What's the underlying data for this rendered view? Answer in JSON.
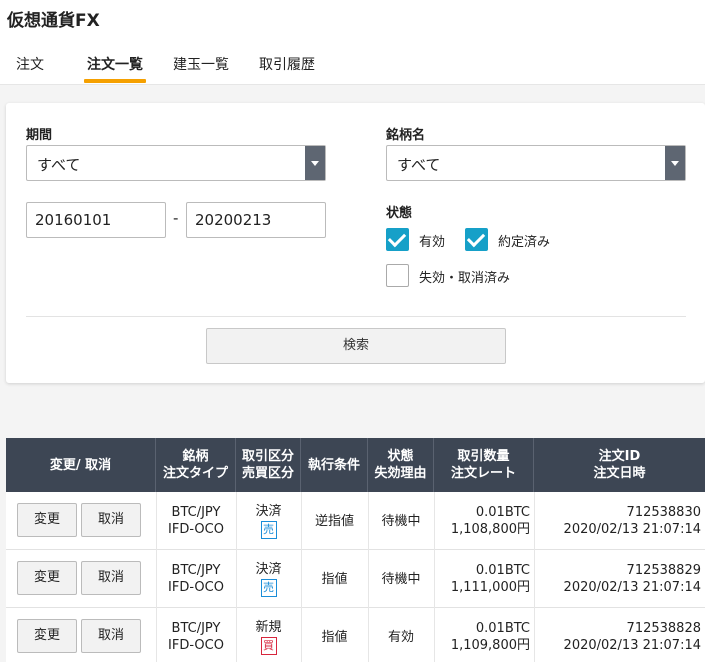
{
  "app": {
    "title": "仮想通貨FX"
  },
  "tabs": [
    {
      "label": "注文"
    },
    {
      "label": "注文一覧"
    },
    {
      "label": "建玉一覧"
    },
    {
      "label": "取引履歴"
    }
  ],
  "filters": {
    "period_label": "期間",
    "period_select": "すべて",
    "date_from": "20160101",
    "date_separator": "-",
    "date_to": "20200213",
    "symbol_label": "銘柄名",
    "symbol_select": "すべて",
    "status_label": "状態",
    "status_options": [
      {
        "label": "有効",
        "checked": true
      },
      {
        "label": "約定済み",
        "checked": true
      },
      {
        "label": "失効・取消済み",
        "checked": false
      }
    ],
    "search_button": "検索"
  },
  "table": {
    "headers": [
      [
        "変更/ 取消"
      ],
      [
        "銘柄",
        "注文タイプ"
      ],
      [
        "取引区分",
        "売買区分"
      ],
      [
        "執行条件"
      ],
      [
        "状態",
        "失効理由"
      ],
      [
        "取引数量",
        "注文レート"
      ],
      [
        "注文ID",
        "注文日時"
      ]
    ],
    "change_label": "変更",
    "cancel_label": "取消",
    "rows": [
      {
        "symbol": "BTC/JPY",
        "order_type": "IFD-OCO",
        "trade_kind": "決済",
        "side": "売",
        "side_type": "sell",
        "condition": "逆指値",
        "status": "待機中",
        "quantity": "0.01BTC",
        "rate": "1,108,800円",
        "order_id": "712538830",
        "datetime": "2020/02/13 21:07:14"
      },
      {
        "symbol": "BTC/JPY",
        "order_type": "IFD-OCO",
        "trade_kind": "決済",
        "side": "売",
        "side_type": "sell",
        "condition": "指値",
        "status": "待機中",
        "quantity": "0.01BTC",
        "rate": "1,111,000円",
        "order_id": "712538829",
        "datetime": "2020/02/13 21:07:14"
      },
      {
        "symbol": "BTC/JPY",
        "order_type": "IFD-OCO",
        "trade_kind": "新規",
        "side": "買",
        "side_type": "buy",
        "condition": "指値",
        "status": "有効",
        "quantity": "0.01BTC",
        "rate": "1,109,800円",
        "order_id": "712538828",
        "datetime": "2020/02/13 21:07:14"
      }
    ]
  },
  "colors": {
    "accent": "#f5a000",
    "check": "#16a0c8",
    "header_bg": "#3d4654",
    "sell": "#1a8dd8",
    "buy": "#d7263d"
  }
}
